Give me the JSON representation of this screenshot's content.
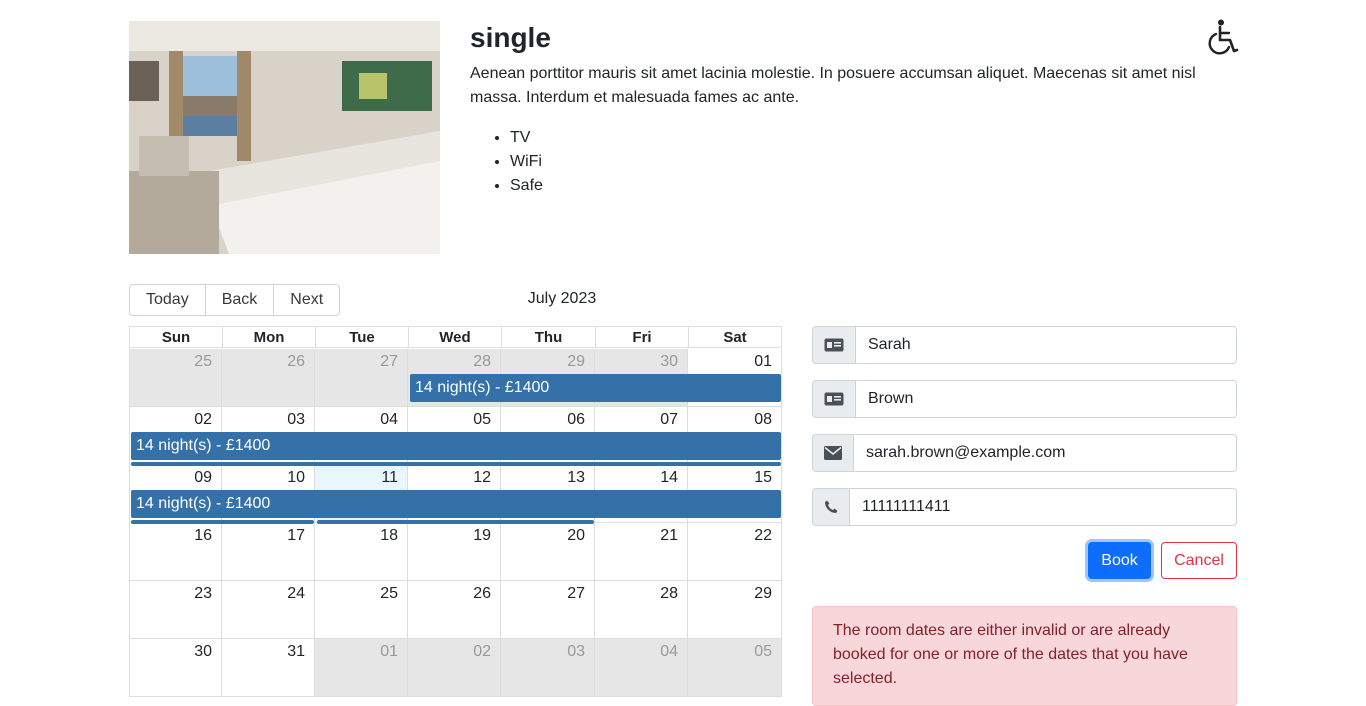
{
  "room": {
    "title": "single",
    "description": "Aenean porttitor mauris sit amet lacinia molestie. In posuere accumsan aliquet. Maecenas sit amet nisl massa. Interdum et malesuada fames ac ante.",
    "features": [
      "TV",
      "WiFi",
      "Safe"
    ]
  },
  "calendar": {
    "toolbar": {
      "today": "Today",
      "back": "Back",
      "next": "Next"
    },
    "month_label": "July 2023",
    "weekdays": [
      "Sun",
      "Mon",
      "Tue",
      "Wed",
      "Thu",
      "Fri",
      "Sat"
    ],
    "weeks": [
      [
        "25",
        "26",
        "27",
        "28",
        "29",
        "30",
        "01"
      ],
      [
        "02",
        "03",
        "04",
        "05",
        "06",
        "07",
        "08"
      ],
      [
        "09",
        "10",
        "11",
        "12",
        "13",
        "14",
        "15"
      ],
      [
        "16",
        "17",
        "18",
        "19",
        "20",
        "21",
        "22"
      ],
      [
        "23",
        "24",
        "25",
        "26",
        "27",
        "28",
        "29"
      ],
      [
        "30",
        "31",
        "01",
        "02",
        "03",
        "04",
        "05"
      ]
    ],
    "booking_label": "14 night(s) - £1400"
  },
  "form": {
    "firstname": "Sarah",
    "lastname": "Brown",
    "email": "sarah.brown@example.com",
    "phone": "11111111411",
    "book_label": "Book",
    "cancel_label": "Cancel"
  },
  "alert": {
    "message": "The room dates are either invalid or are already booked for one or more of the dates that you have selected."
  },
  "colors": {
    "primary": "#0d6efd",
    "event": "#3571a9",
    "danger": "#dc3545",
    "alert_bg": "#f8d7da"
  }
}
